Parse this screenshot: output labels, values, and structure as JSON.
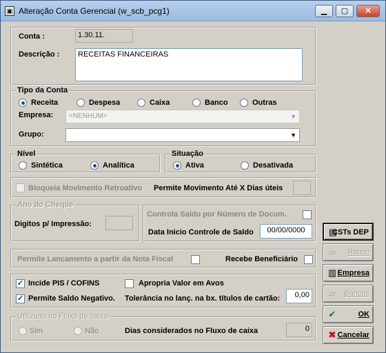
{
  "window": {
    "title": "Alteração Conta Gerencial (w_scb_pcg1)",
    "icon": "window-app-icon"
  },
  "conta": {
    "label": "Conta :",
    "value": "1.30.11."
  },
  "descricao": {
    "label": "Descrição :",
    "value": "RECEITAS FINANCEIRAS"
  },
  "tipo_conta": {
    "title": "Tipo da Conta",
    "options": [
      "Receita",
      "Despesa",
      "Caixa",
      "Banco",
      "Outras"
    ],
    "selected": "Receita",
    "empresa_label": "Empresa:",
    "empresa_value": "<NENHUM>",
    "grupo_label": "Grupo:",
    "grupo_value": ""
  },
  "nivel": {
    "title": "Nível",
    "options": [
      "Sintética",
      "Analítica"
    ],
    "selected": "Analítica"
  },
  "situacao": {
    "title": "Situação",
    "options": [
      "Ativa",
      "Desativada"
    ],
    "selected": "Ativa"
  },
  "bloqueia": {
    "label": "Bloqueia Movimento Retroativo",
    "checked": false,
    "permite_label": "Permite Movimento Até X Dias úteis",
    "permite_value": ""
  },
  "ano_cheque": {
    "title": "Ano do Cheque",
    "digitos_label": "Digitos p/ Impressão:",
    "digitos_value": ""
  },
  "controla_saldo": {
    "label": "Controla  Saldo por Número de Docum.",
    "checked": false,
    "data_label": "Data Inicio Controle de Saldo",
    "data_value": "00/00/0000"
  },
  "nota_fiscal": {
    "label": "Permite Lancamento a partir da Nota Fiscal",
    "checked": false,
    "recebe_label": "Recebe Beneficiário",
    "recebe_checked": false
  },
  "pis": {
    "incide_label": "Incide PIS / COFINS",
    "incide_checked": true,
    "apropria_label": "Apropria Valor em Avos",
    "apropria_checked": false,
    "saldo_label": "Permite Saldo Negativo.",
    "saldo_checked": true,
    "tolerancia_label": "Tolerância no lanç. na bx. títulos de cartão:",
    "tolerancia_value": "0,00"
  },
  "fluxo": {
    "title": "Utilizada no Fluxo de caixa",
    "sim": "Sim",
    "nao": "Não",
    "dias_label": "Dias considerados no Fluxo de caixa",
    "dias_value": "0"
  },
  "buttons": {
    "csts": "CSTs DEP",
    "rateio": "Rateio",
    "empresa": "Empresa",
    "bancos": "Bancos",
    "ok": "OK",
    "cancelar": "Cancelar"
  }
}
